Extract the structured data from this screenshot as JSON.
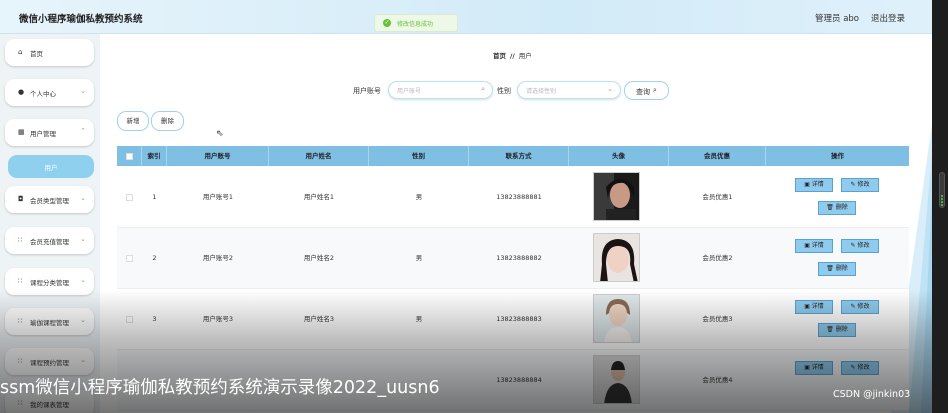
{
  "header": {
    "app_title": "微信小程序瑜伽私教预约系统",
    "toast": "修改信息成功",
    "admin_label": "管理员 abo",
    "logout_label": "退出登录"
  },
  "sidebar": {
    "items": [
      {
        "icon": "home-icon",
        "label": "首页"
      },
      {
        "icon": "user-icon",
        "label": "个人中心"
      },
      {
        "icon": "grid-icon",
        "label": "用户管理"
      },
      {
        "icon": "tag-icon",
        "label": "会员类型管理"
      },
      {
        "icon": "apps-icon",
        "label": "会员充值管理"
      },
      {
        "icon": "apps-icon",
        "label": "课程分类管理"
      },
      {
        "icon": "apps-icon",
        "label": "瑜伽课程管理"
      },
      {
        "icon": "apps-icon",
        "label": "课程预约管理"
      },
      {
        "icon": "apps-icon",
        "label": "我的课表管理"
      }
    ],
    "active_sub_label": "用户"
  },
  "breadcrumb": {
    "home": "首页",
    "separator": "//",
    "current": "用户"
  },
  "search": {
    "account_label": "用户账号",
    "account_placeholder": "用户账号",
    "gender_label": "性别",
    "gender_placeholder": "请选择性别",
    "query_label": "查询"
  },
  "actions": {
    "add_label": "新增",
    "delete_label": "删除"
  },
  "table": {
    "headers": [
      "索引",
      "用户账号",
      "用户姓名",
      "性别",
      "联系方式",
      "头像",
      "会员优惠",
      "操作"
    ],
    "detail_label": "详情",
    "edit_label": "修改",
    "delete_label": "删除",
    "rows": [
      {
        "index": "1",
        "account": "用户账号1",
        "name": "用户姓名1",
        "gender": "男",
        "phone": "13823888881",
        "discount": "会员优惠1"
      },
      {
        "index": "2",
        "account": "用户账号2",
        "name": "用户姓名2",
        "gender": "男",
        "phone": "13823888882",
        "discount": "会员优惠2"
      },
      {
        "index": "3",
        "account": "用户账号3",
        "name": "用户姓名3",
        "gender": "男",
        "phone": "13823888883",
        "discount": "会员优惠3"
      },
      {
        "index": "4",
        "account": "",
        "name": "",
        "gender": "",
        "phone": "13823888884",
        "discount": "会员优惠4"
      }
    ]
  },
  "video_overlay": {
    "caption": "ssm微信小程序瑜伽私教预约系统演示录像2022_uusn6",
    "watermark": "CSDN @jinkin03"
  },
  "colors": {
    "accent": "#7fbfe3",
    "active_menu": "#8fd0ee",
    "action_button": "#8fcbee"
  }
}
